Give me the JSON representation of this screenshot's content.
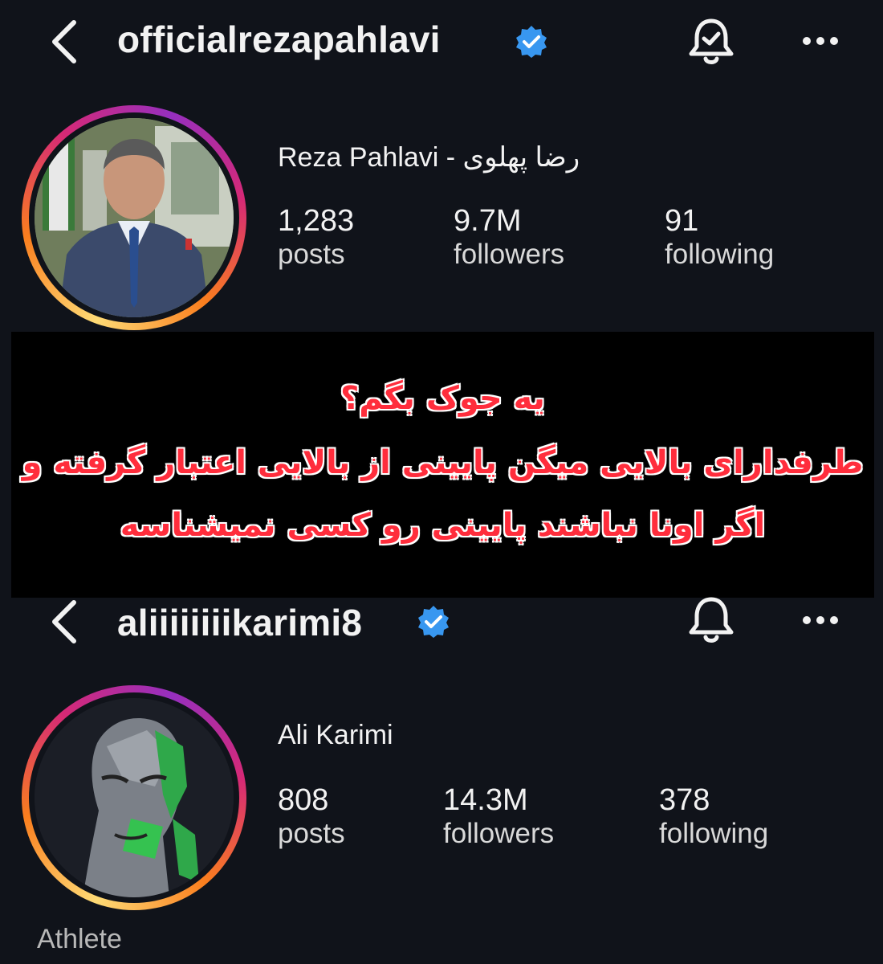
{
  "profile_top": {
    "username": "officialrezapahlavi",
    "display_name": "Reza Pahlavi - رضا پهلوی",
    "stats": [
      {
        "value": "1,283",
        "label": "posts"
      },
      {
        "value": "9.7M",
        "label": "followers"
      },
      {
        "value": "91",
        "label": "following"
      }
    ],
    "avatar_icon": "portrait-photo"
  },
  "banner": {
    "lines": [
      "یه جوک بگم؟",
      "طرفدارای بالایی میگن پایینی از بالایی اعتبار گرفته و",
      "اگر اونا نباشند پایینی رو کسی نمیشناسه"
    ],
    "text_color": "#ff2d3c"
  },
  "profile_bottom": {
    "username": "aliiiiiiiikarimi8",
    "display_name": "Ali Karimi",
    "stats": [
      {
        "value": "808",
        "label": "posts"
      },
      {
        "value": "14.3M",
        "label": "followers"
      },
      {
        "value": "378",
        "label": "following"
      }
    ],
    "category": "Athlete",
    "avatar_icon": "stylized-portrait"
  },
  "colors": {
    "background": "#10131a",
    "verified_badge": "#3897f0"
  }
}
